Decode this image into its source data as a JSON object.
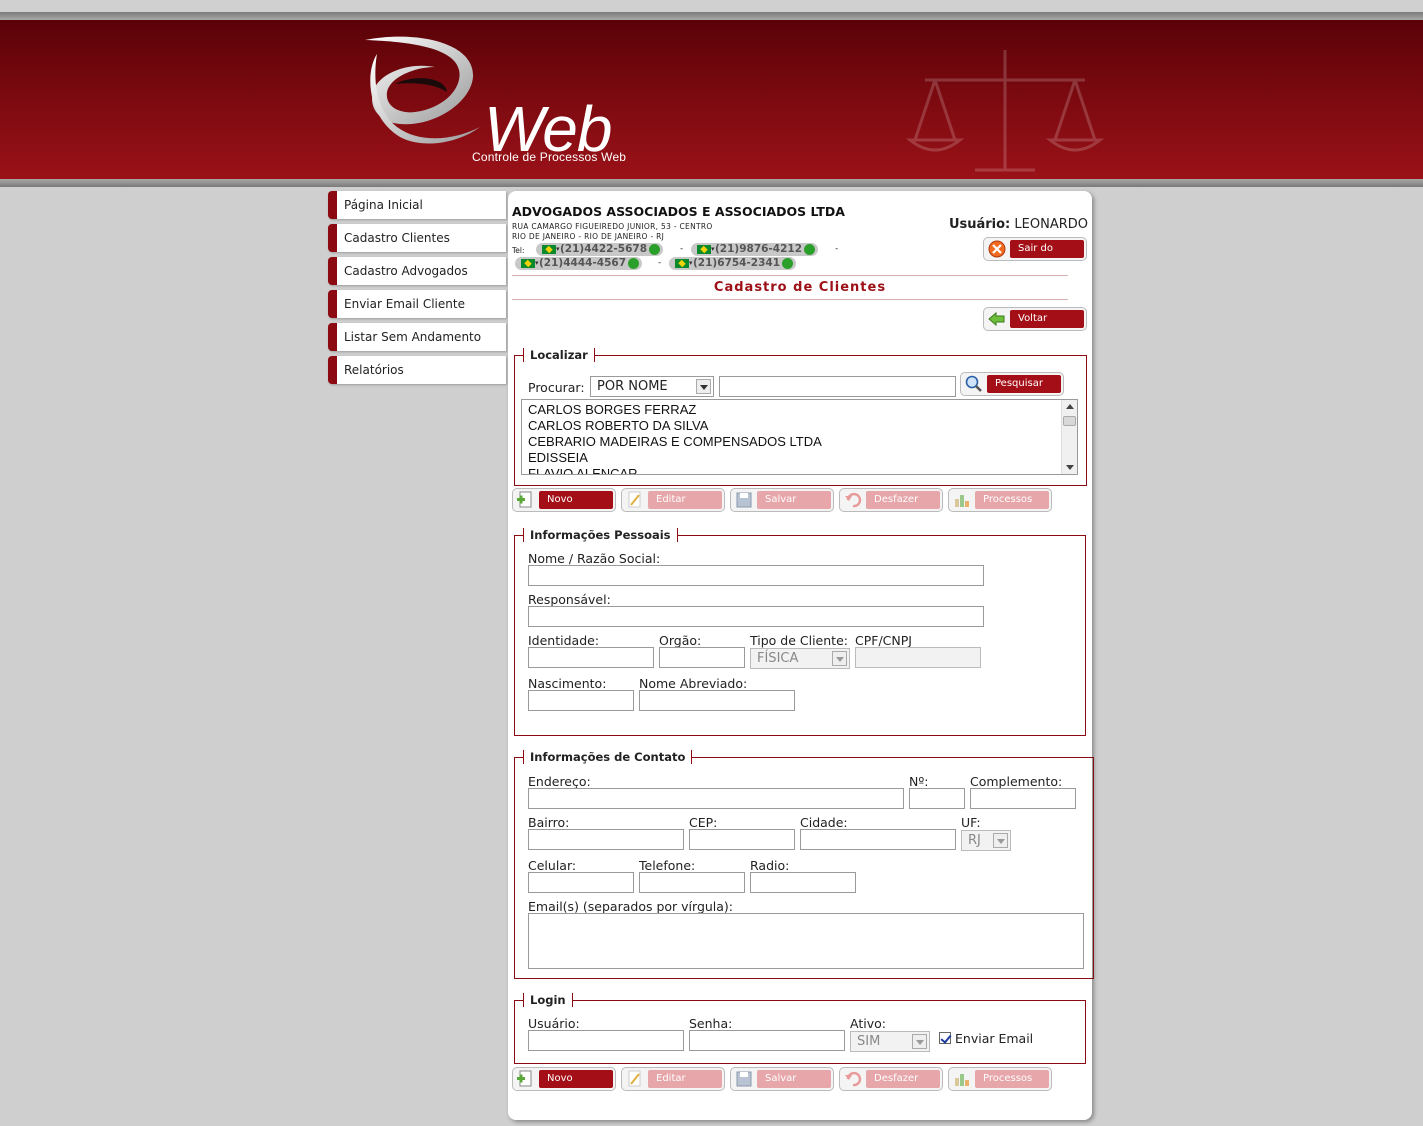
{
  "header": {
    "logo_text": "Web",
    "logo_subtitle": "Controle de Processos Web"
  },
  "sidebar": {
    "items": [
      {
        "label": "Página Inicial"
      },
      {
        "label": "Cadastro Clientes"
      },
      {
        "label": "Cadastro Advogados"
      },
      {
        "label": "Enviar Email Cliente"
      },
      {
        "label": "Listar Sem Andamento"
      },
      {
        "label": "Relatórios"
      }
    ]
  },
  "company": {
    "name": "ADVOGADOS ASSOCIADOS E ASSOCIADOS LTDA",
    "address_line1": "RUA CAMARGO FIGUEIREDO JUNIOR, 53 - CENTRO",
    "address_line2": "RIO DE JANEIRO - RIO DE JANEIRO - RJ",
    "tel_label": "Tel:",
    "phones": [
      "(21)4422-5678",
      "(21)9876-4212",
      "(21)4444-4567",
      "(21)6754-2341"
    ],
    "phone_separator": "-"
  },
  "user": {
    "label": "Usuário:",
    "name": "LEONARDO",
    "logout_label": "Sair do Sistema"
  },
  "page_title": "Cadastro de Clientes",
  "back_label": "Voltar",
  "localizar": {
    "legend": "Localizar",
    "search_label": "Procurar:",
    "search_mode": "POR NOME",
    "search_value": "",
    "search_button": "Pesquisar",
    "results": [
      "CARLOS BORGES FERRAZ",
      "CARLOS ROBERTO DA SILVA",
      "CEBRARIO MADEIRAS E COMPENSADOS LTDA",
      "EDISSEIA",
      "FLAVIO ALENCAR"
    ]
  },
  "actions": {
    "novo": "Novo",
    "editar": "Editar",
    "salvar": "Salvar",
    "desfazer": "Desfazer",
    "processos": "Processos"
  },
  "pessoais": {
    "legend": "Informações Pessoais",
    "nome_label": "Nome / Razão Social:",
    "responsavel_label": "Responsável:",
    "identidade_label": "Identidade:",
    "orgao_label": "Orgão:",
    "tipo_label": "Tipo de Cliente:",
    "tipo_value": "FÍSICA",
    "cpf_label": "CPF/CNPJ",
    "nascimento_label": "Nascimento:",
    "apelido_label": "Nome Abreviado:"
  },
  "contato": {
    "legend": "Informações de Contato",
    "endereco_label": "Endereço:",
    "numero_label": "Nº:",
    "complemento_label": "Complemento:",
    "bairro_label": "Bairro:",
    "cep_label": "CEP:",
    "cidade_label": "Cidade:",
    "uf_label": "UF:",
    "uf_value": "RJ",
    "celular_label": "Celular:",
    "telefone_label": "Telefone:",
    "radio_label": "Radio:",
    "emails_label": "Email(s) (separados por vírgula):"
  },
  "login": {
    "legend": "Login",
    "usuario_label": "Usuário:",
    "senha_label": "Senha:",
    "ativo_label": "Ativo:",
    "ativo_value": "SIM",
    "enviar_email_label": "Enviar Email",
    "enviar_email_checked": true
  },
  "colors": {
    "brand_red": "#8c0a12",
    "button_red": "#a40f17",
    "disabled_red": "#e6a6aa",
    "background": "#cfcfcf"
  }
}
